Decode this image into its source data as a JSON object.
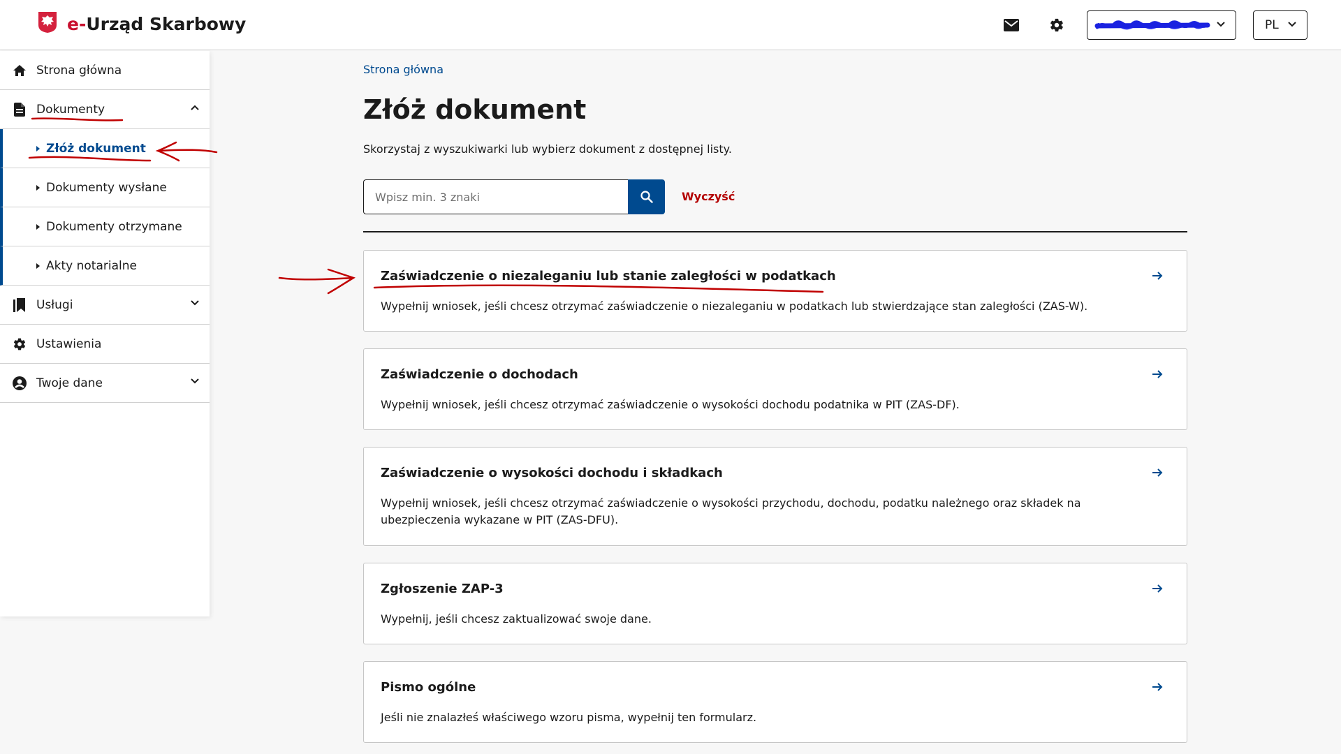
{
  "header": {
    "brand_prefix": "e-",
    "brand_name": "Urząd Skarbowy",
    "lang_label": "PL",
    "icons": [
      "mail-icon",
      "gear-icon",
      "chevron-down-icon"
    ],
    "accent_color": "#004a8f",
    "brand_red": "#c8102e"
  },
  "sidebar": {
    "items": [
      {
        "label": "Strona główna",
        "icon": "home-icon"
      },
      {
        "label": "Dokumenty",
        "icon": "document-icon",
        "expanded": true
      },
      {
        "label": "Usługi",
        "icon": "bookmark-icon",
        "expanded": false
      },
      {
        "label": "Ustawienia",
        "icon": "gear-icon"
      },
      {
        "label": "Twoje dane",
        "icon": "user-circle-icon",
        "expanded": false
      }
    ],
    "sub_items": [
      {
        "label": "Złóż dokument",
        "active": true
      },
      {
        "label": "Dokumenty wysłane"
      },
      {
        "label": "Dokumenty otrzymane"
      },
      {
        "label": "Akty notarialne"
      }
    ]
  },
  "main": {
    "breadcrumb": "Strona główna",
    "title": "Złóż dokument",
    "lead": "Skorzystaj z wyszukiwarki lub wybierz dokument z dostępnej listy.",
    "search": {
      "placeholder": "Wpisz min. 3 znaki",
      "value": ""
    },
    "clear_label": "Wyczyść",
    "cards": [
      {
        "title": "Zaświadczenie o niezaleganiu lub stanie zaległości w podatkach",
        "description": "Wypełnij wniosek, jeśli chcesz otrzymać zaświadczenie o niezaleganiu w podatkach lub stwierdzające stan zaległości (ZAS-W)."
      },
      {
        "title": "Zaświadczenie o dochodach",
        "description": "Wypełnij wniosek, jeśli chcesz otrzymać zaświadczenie o wysokości dochodu podatnika w PIT (ZAS-DF)."
      },
      {
        "title": "Zaświadczenie o wysokości dochodu i składkach",
        "description": "Wypełnij wniosek, jeśli chcesz otrzymać zaświadczenie o wysokości przychodu, dochodu, podatku należnego oraz składek na ubezpieczenia wykazane w PIT (ZAS-DFU)."
      },
      {
        "title": "Zgłoszenie ZAP-3",
        "description": "Wypełnij, jeśli chcesz zaktualizować swoje dane."
      },
      {
        "title": "Pismo ogólne",
        "description": "Jeśli nie znalazłeś właściwego wzoru pisma, wypełnij ten formularz."
      }
    ]
  },
  "annotations": {
    "color": "#c00000"
  }
}
